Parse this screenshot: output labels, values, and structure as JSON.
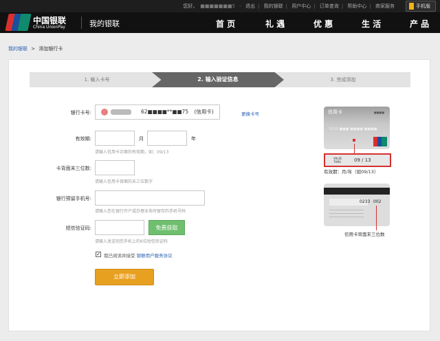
{
  "topbar": {
    "greeting": "您好，",
    "user": "■■■■■■■5",
    "links": [
      "退出",
      "我的银联",
      "用户中心",
      "订单查询",
      "帮助中心",
      "商家服务"
    ],
    "mobile": "手机版"
  },
  "header": {
    "brand_cn": "中国银联",
    "brand_en": "China UnionPay",
    "title": "我的银联",
    "nav": [
      "首 页",
      "礼 遇",
      "优 惠",
      "生 活",
      "产 品"
    ]
  },
  "breadcrumb": {
    "home": "我的银联",
    "sep": ">",
    "current": "添加银行卡"
  },
  "steps": [
    "1. 输入卡号",
    "2. 输入验证信息",
    "3. 完成添加"
  ],
  "form": {
    "card_label": "银行卡号:",
    "card_value": "62■■■■**■■75",
    "card_type": "(信用卡)",
    "change_card": "更换卡号",
    "expiry_label": "有效期:",
    "month_unit": "月",
    "year_unit": "年",
    "expiry_hint": "请输入信用卡正面的有效期，如：09/13",
    "cvv_label": "卡背面末三位数:",
    "cvv_hint": "请输入信用卡背面的末三位数字",
    "phone_label": "银行预留手机号:",
    "phone_hint": "请输入您在银行开户或办理业务时留存的手机号码",
    "sms_label": "短信验证码:",
    "sms_button": "免费获取",
    "sms_hint": "请输入发送到您手机上的6位短信验证码",
    "agree_text": "我已阅读并接受",
    "agree_link": "银联用户服务协议",
    "submit": "立即添加"
  },
  "help": {
    "card_title": "信用卡",
    "card_mini": "■■■■",
    "card_number": "6225 ■■■ ■■■■ ■■■■",
    "valid_thru": "VALID THRU",
    "expiry_example": "09 / 13",
    "expiry_caption": "有效期：月/年（如09/13）",
    "cvv_sample_a": "0233",
    "cvv_sample_b": "002",
    "back_caption": "信用卡背面末三位数"
  },
  "colors": {
    "accent": "#e8a020",
    "sms_green": "#6fbf6f",
    "link": "#2a60b0",
    "highlight_red": "#d43030"
  }
}
